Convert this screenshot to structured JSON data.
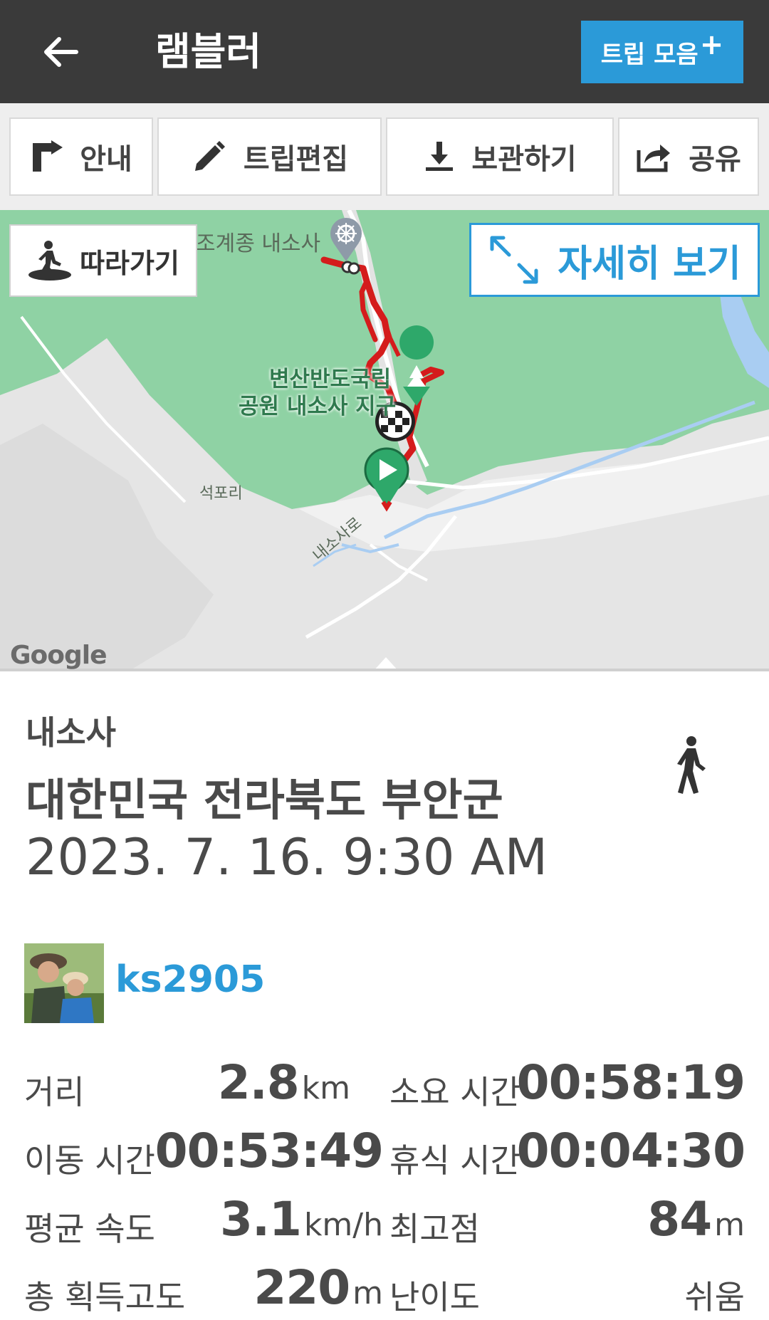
{
  "header": {
    "title": "램블러",
    "trip_collection": "트립 모음"
  },
  "toolbar": {
    "guide": "안내",
    "edit_trip": "트립편집",
    "save": "보관하기",
    "share": "공유"
  },
  "map": {
    "follow": "따라가기",
    "view_detail": "자세히 보기",
    "labels": {
      "temple": "조계종 내소사",
      "park_line1": "변산반도국립",
      "park_line2": "공원 내소사 지구",
      "village": "석포리",
      "road": "내소사로"
    },
    "logo": "Google"
  },
  "trip": {
    "place": "내소사",
    "region": "대한민국 전라북도 부안군",
    "datetime": "2023. 7. 16. 9:30 AM",
    "user": "ks2905"
  },
  "stats": {
    "distance_label": "거리",
    "distance_value": "2.8",
    "distance_unit": "km",
    "duration_label": "소요 시간",
    "duration_value": "00:58:19",
    "moving_label": "이동 시간",
    "moving_value": "00:53:49",
    "rest_label": "휴식 시간",
    "rest_value": "00:04:30",
    "speed_label": "평균 속도",
    "speed_value": "3.1",
    "speed_unit": "km/h",
    "highest_label": "최고점",
    "highest_value": "84",
    "highest_unit": "m",
    "gain_label": "총 획득고도",
    "gain_value": "220",
    "gain_unit": "m",
    "difficulty_label": "난이도",
    "difficulty_value": "쉬움"
  },
  "colors": {
    "header_bg": "#3a3a3a",
    "accent": "#2b9ad8",
    "track": "#d41c1c",
    "map_green": "#8fd2a4",
    "map_gray": "#e6e6e6"
  }
}
